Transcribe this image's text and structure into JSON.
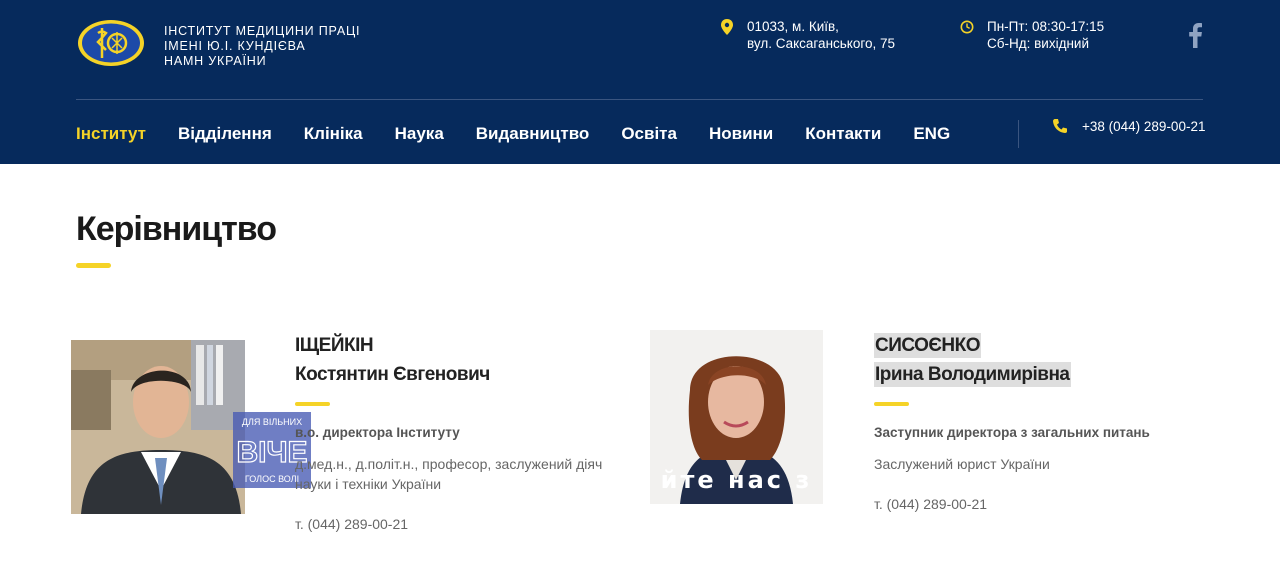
{
  "header": {
    "logo_lines": [
      "ІНСТИТУТ МЕДИЦИНИ ПРАЦІ",
      "ІМЕНІ Ю.І. КУНДІЄВА",
      "НАМН УКРАЇНИ"
    ],
    "address": [
      "01033, м. Київ,",
      "вул. Саксаганського, 75"
    ],
    "hours": [
      "Пн-Пт: 08:30-17:15",
      "Сб-Нд: вихідний"
    ],
    "social_icon": "facebook-icon",
    "accent": "#f5d327",
    "bg": "#062a5c"
  },
  "nav": {
    "items": [
      {
        "label": "Інститут",
        "active": true
      },
      {
        "label": "Відділення"
      },
      {
        "label": "Клініка"
      },
      {
        "label": "Наука"
      },
      {
        "label": "Видавництво"
      },
      {
        "label": "Освіта"
      },
      {
        "label": "Новини"
      },
      {
        "label": "Контакти"
      },
      {
        "label": "ENG"
      }
    ],
    "phone": "+38 (044) 289-00-21"
  },
  "page": {
    "title": "Керівництво"
  },
  "people": [
    {
      "surname": "ІЩЕЙКІН",
      "given": "Костянтин Євгенович",
      "position": "в.о. директора Інституту",
      "desc": [
        "д.мед.н., д.політ.н., професор, заслужений діяч",
        "науки і техніки України"
      ],
      "tel": "т. (044) 289-00-21",
      "watermark": [
        "ДЛЯ ВІЛЬНИХ",
        "ВІЧЕ",
        "ГОЛОС ВОЛІ"
      ]
    },
    {
      "surname": "СИСОЄНКО",
      "given": "Ірина Володимирівна",
      "position": "Заступник директора з загальних питань",
      "desc": [
        "Заслужений юрист України"
      ],
      "tel": "т. (044) 289-00-21",
      "overlay": "йте нас з"
    }
  ]
}
